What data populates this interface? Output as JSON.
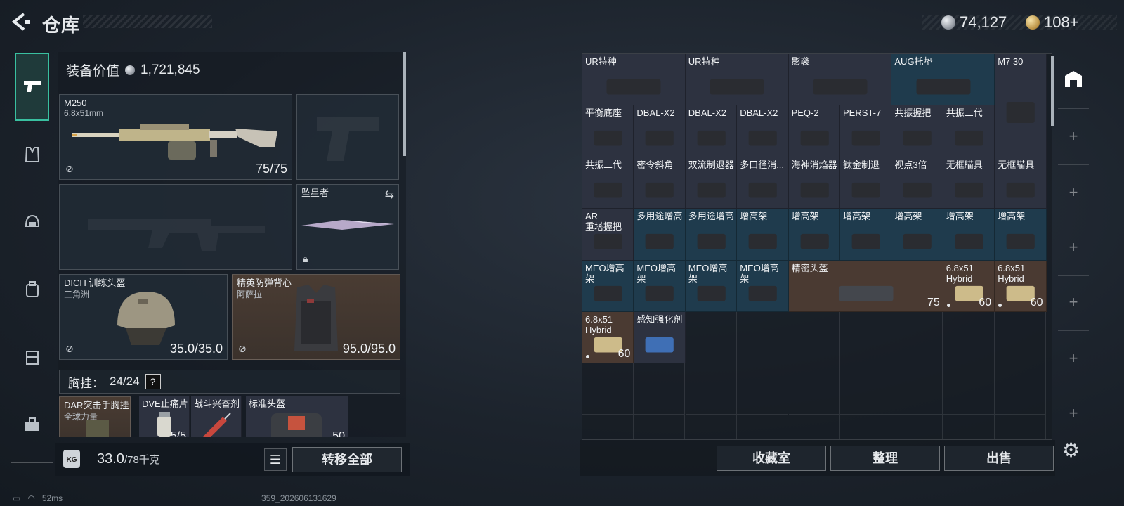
{
  "header": {
    "title": "仓库",
    "currencies": [
      {
        "icon": "silver-coin-icon",
        "value": "74,127"
      },
      {
        "icon": "gold-coin-icon",
        "value": "108+"
      }
    ]
  },
  "left_tabs": [
    {
      "icon": "pistol-icon",
      "active": true
    },
    {
      "icon": "vest-icon",
      "active": false
    },
    {
      "icon": "helmet-icon",
      "active": false
    },
    {
      "icon": "backpack-icon",
      "active": false
    },
    {
      "icon": "case-icon",
      "active": false
    },
    {
      "icon": "toolbox-icon",
      "active": false
    }
  ],
  "equipment": {
    "value_label": "装备价值",
    "value": "1,721,845",
    "primary": {
      "name": "M250",
      "caliber": "6.8x51mm",
      "durability": "75/75"
    },
    "melee": {
      "name": "坠星者"
    },
    "helmet": {
      "name": "DICH 训练头盔",
      "sub": "三角洲",
      "durability": "35.0/35.0"
    },
    "armor": {
      "name": "精英防弹背心",
      "sub": "阿萨拉",
      "durability": "95.0/95.0"
    },
    "chest_rig_label": "胸挂：",
    "chest_rig_count": "24/24",
    "chest_rig_info": "?",
    "chest_items": [
      {
        "name": "DAR突击手胸挂",
        "sub": "全球力量"
      },
      {
        "name": "DVE止痛片",
        "count": "5/5"
      },
      {
        "name": "战斗兴奋剂"
      },
      {
        "name": "标准头盔",
        "count": "50"
      }
    ]
  },
  "weight": {
    "current": "33.0",
    "max": "/78千克",
    "icon_label": "KG"
  },
  "buttons": {
    "list": "☰",
    "transfer_all": "转移全部",
    "collection": "收藏室",
    "organize": "整理",
    "sell": "出售"
  },
  "grid_items": [
    {
      "label": "UR特种",
      "color": "dark"
    },
    {
      "label": "UR特种",
      "color": "dark"
    },
    {
      "label": "影袭",
      "color": "dark"
    },
    {
      "label": "AUG托垫",
      "color": "teal"
    },
    {
      "label": "M7 30",
      "color": "dark"
    },
    {
      "label": "平衡底座",
      "color": "dark"
    },
    {
      "label": "DBAL-X2",
      "color": "dark"
    },
    {
      "label": "DBAL-X2",
      "color": "dark"
    },
    {
      "label": "DBAL-X2",
      "color": "dark"
    },
    {
      "label": "PEQ-2",
      "color": "dark"
    },
    {
      "label": "PERST-7",
      "color": "dark"
    },
    {
      "label": "共振握把",
      "color": "dark"
    },
    {
      "label": "共振二代",
      "color": "dark"
    },
    {
      "label": "共振二代",
      "color": "dark"
    },
    {
      "label": "密令斜角",
      "color": "dark"
    },
    {
      "label": "双流制退器",
      "color": "dark"
    },
    {
      "label": "多口径消...",
      "color": "dark"
    },
    {
      "label": "海神消焰器",
      "color": "dark"
    },
    {
      "label": "钛金制退",
      "color": "dark"
    },
    {
      "label": "视点3倍",
      "color": "dark"
    },
    {
      "label": "无框瞄具",
      "color": "dark"
    },
    {
      "label": "无框瞄具",
      "color": "dark"
    },
    {
      "label": "AR\n重塔握把",
      "color": "dark"
    },
    {
      "label": "多用途增高",
      "color": "teal"
    },
    {
      "label": "多用途增高",
      "color": "teal"
    },
    {
      "label": "增高架",
      "color": "teal"
    },
    {
      "label": "增高架",
      "color": "teal"
    },
    {
      "label": "增高架",
      "color": "teal"
    },
    {
      "label": "增高架",
      "color": "teal"
    },
    {
      "label": "增高架",
      "color": "teal"
    },
    {
      "label": "增高架",
      "color": "teal"
    },
    {
      "label": "MEO增高架",
      "color": "teal"
    },
    {
      "label": "MEO增高架",
      "color": "teal"
    },
    {
      "label": "MEO增高架",
      "color": "teal"
    },
    {
      "label": "MEO增高架",
      "color": "teal"
    },
    {
      "label": "精密头盔",
      "color": "brown",
      "count": "75"
    },
    {
      "label": "6.8x51\nHybrid",
      "color": "brown",
      "count": "60"
    },
    {
      "label": "6.8x51\nHybrid",
      "color": "brown",
      "count": "60"
    },
    {
      "label": "6.8x51\nHybrid",
      "color": "brown",
      "count": "60"
    },
    {
      "label": "感知强化剂",
      "color": "dark"
    }
  ],
  "status": {
    "ping": "52ms",
    "build": "359_202606131629"
  }
}
